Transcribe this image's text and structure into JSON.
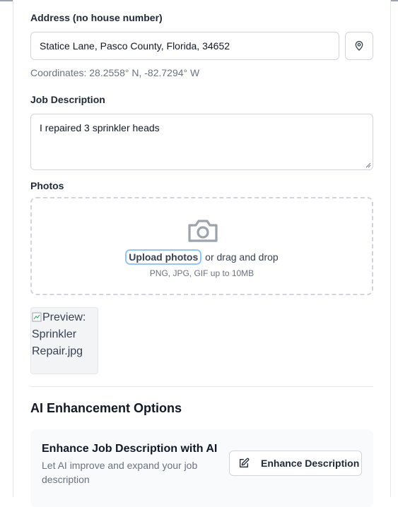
{
  "address": {
    "label": "Address (no house number)",
    "value": "Statice Lane, Pasco County, Florida, 34652",
    "location_icon": "map-pin-icon",
    "coordinates": "Coordinates: 28.2558° N, -82.7294° W"
  },
  "job_description": {
    "label": "Job Description",
    "value": "I repaired 3 sprinkler heads"
  },
  "photos": {
    "label": "Photos",
    "upload_icon": "camera-icon",
    "upload_link": "Upload photos",
    "drag_text": "or drag and drop",
    "hint": "PNG, JPG, GIF up to 10MB",
    "preview_alt": "Preview: Sprinkler Repair.jpg"
  },
  "ai": {
    "section_title": "AI Enhancement Options",
    "enhance_title": "Enhance Job Description with AI",
    "enhance_desc": "Let AI improve and expand your job description",
    "button_icon": "edit-icon",
    "button_label": "Enhance Description"
  },
  "colors": {
    "focus_ring": "#93c5fd",
    "border": "#d1d5db",
    "muted_text": "#6b7280",
    "panel_bg": "#f9fafb"
  }
}
